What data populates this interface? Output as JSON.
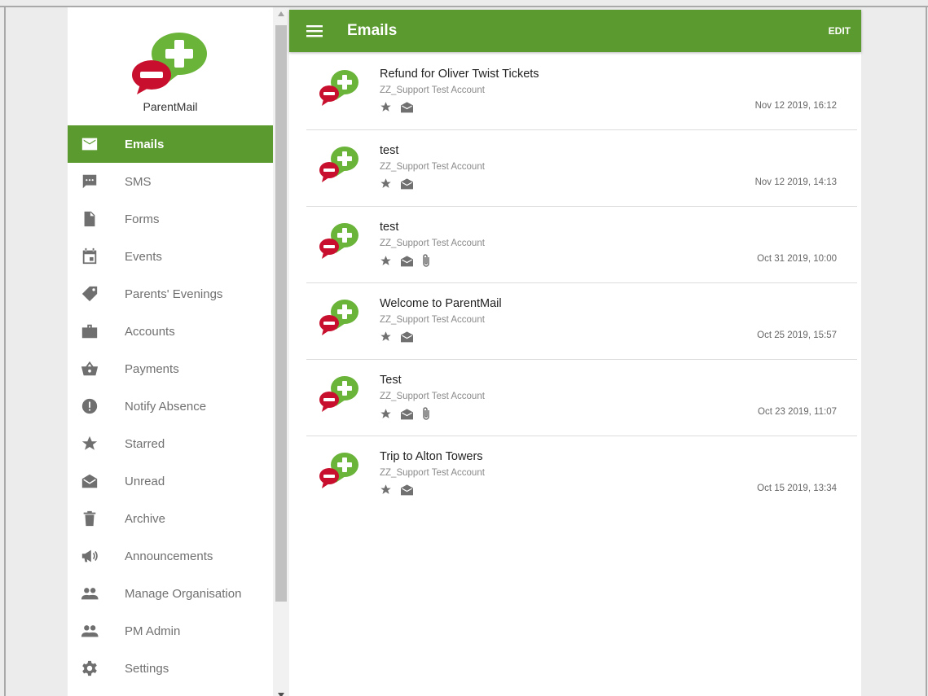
{
  "brand": {
    "name": "ParentMail"
  },
  "header": {
    "title": "Emails",
    "edit_label": "EDIT"
  },
  "sidebar": {
    "items": [
      {
        "label": "Emails",
        "icon": "envelope-icon",
        "active": true
      },
      {
        "label": "SMS",
        "icon": "sms-icon"
      },
      {
        "label": "Forms",
        "icon": "document-icon"
      },
      {
        "label": "Events",
        "icon": "calendar-icon"
      },
      {
        "label": "Parents' Evenings",
        "icon": "tag-icon"
      },
      {
        "label": "Accounts",
        "icon": "briefcase-icon"
      },
      {
        "label": "Payments",
        "icon": "basket-icon"
      },
      {
        "label": "Notify Absence",
        "icon": "alert-icon"
      },
      {
        "label": "Starred",
        "icon": "star-icon"
      },
      {
        "label": "Unread",
        "icon": "open-envelope-icon"
      },
      {
        "label": "Archive",
        "icon": "trash-icon"
      },
      {
        "label": "Announcements",
        "icon": "megaphone-icon"
      },
      {
        "label": "Manage Organisation",
        "icon": "people-icon"
      },
      {
        "label": "PM Admin",
        "icon": "people-icon"
      },
      {
        "label": "Settings",
        "icon": "gear-icon"
      }
    ]
  },
  "emails": [
    {
      "subject": "Refund for Oliver Twist Tickets",
      "sender": "ZZ_Support Test Account",
      "date": "Nov 12 2019, 16:12",
      "attachment": false
    },
    {
      "subject": "test",
      "sender": "ZZ_Support Test Account",
      "date": "Nov 12 2019, 14:13",
      "attachment": false
    },
    {
      "subject": "test",
      "sender": "ZZ_Support Test Account",
      "date": "Oct 31 2019, 10:00",
      "attachment": true
    },
    {
      "subject": "Welcome to ParentMail",
      "sender": "ZZ_Support Test Account",
      "date": "Oct 25 2019, 15:57",
      "attachment": false
    },
    {
      "subject": "Test",
      "sender": "ZZ_Support Test Account",
      "date": "Oct 23 2019, 11:07",
      "attachment": true
    },
    {
      "subject": "Trip to Alton Towers",
      "sender": "ZZ_Support Test Account",
      "date": "Oct 15 2019, 13:34",
      "attachment": false
    }
  ],
  "colors": {
    "brand_green": "#5b9a2f",
    "logo_green": "#6ab43a",
    "logo_red": "#c8102e"
  }
}
